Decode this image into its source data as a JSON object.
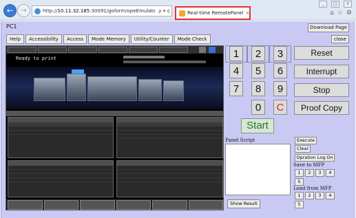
{
  "browser": {
    "url_prefix": "http://",
    "url_host": "10.11.32.185",
    "url_path": ":30091/goform/opeEmulate.cgi",
    "tab_title": "Real-time RemotePanel",
    "tab_close": "×",
    "address_tools": "ρ ▾ ¢"
  },
  "header": {
    "title": "PC1",
    "download_label": "Download Page",
    "close_label": "close"
  },
  "menu": [
    "Help",
    "Accessibility",
    "Access",
    "Mode Memory",
    "Utility/Counter",
    "Mode Check"
  ],
  "screen": {
    "status_text": "Ready to print"
  },
  "keypad": {
    "keys": [
      "1",
      "2",
      "3",
      "4",
      "5",
      "6",
      "7",
      "8",
      "9",
      "0",
      "C"
    ],
    "start_label": "Start"
  },
  "actions": {
    "reset": "Reset",
    "interrupt": "Interrupt",
    "stop": "Stop",
    "proof_copy": "Proof Copy"
  },
  "script_panel": {
    "label": "Panel Script",
    "show_result": "Show Result",
    "execute": "Execute",
    "clear": "Clear",
    "operation_log": "Opration Log On",
    "save_label": "Save to MFP",
    "load_label": "Load from MFP",
    "slots": [
      "1",
      "2",
      "3",
      "4",
      "5"
    ]
  }
}
